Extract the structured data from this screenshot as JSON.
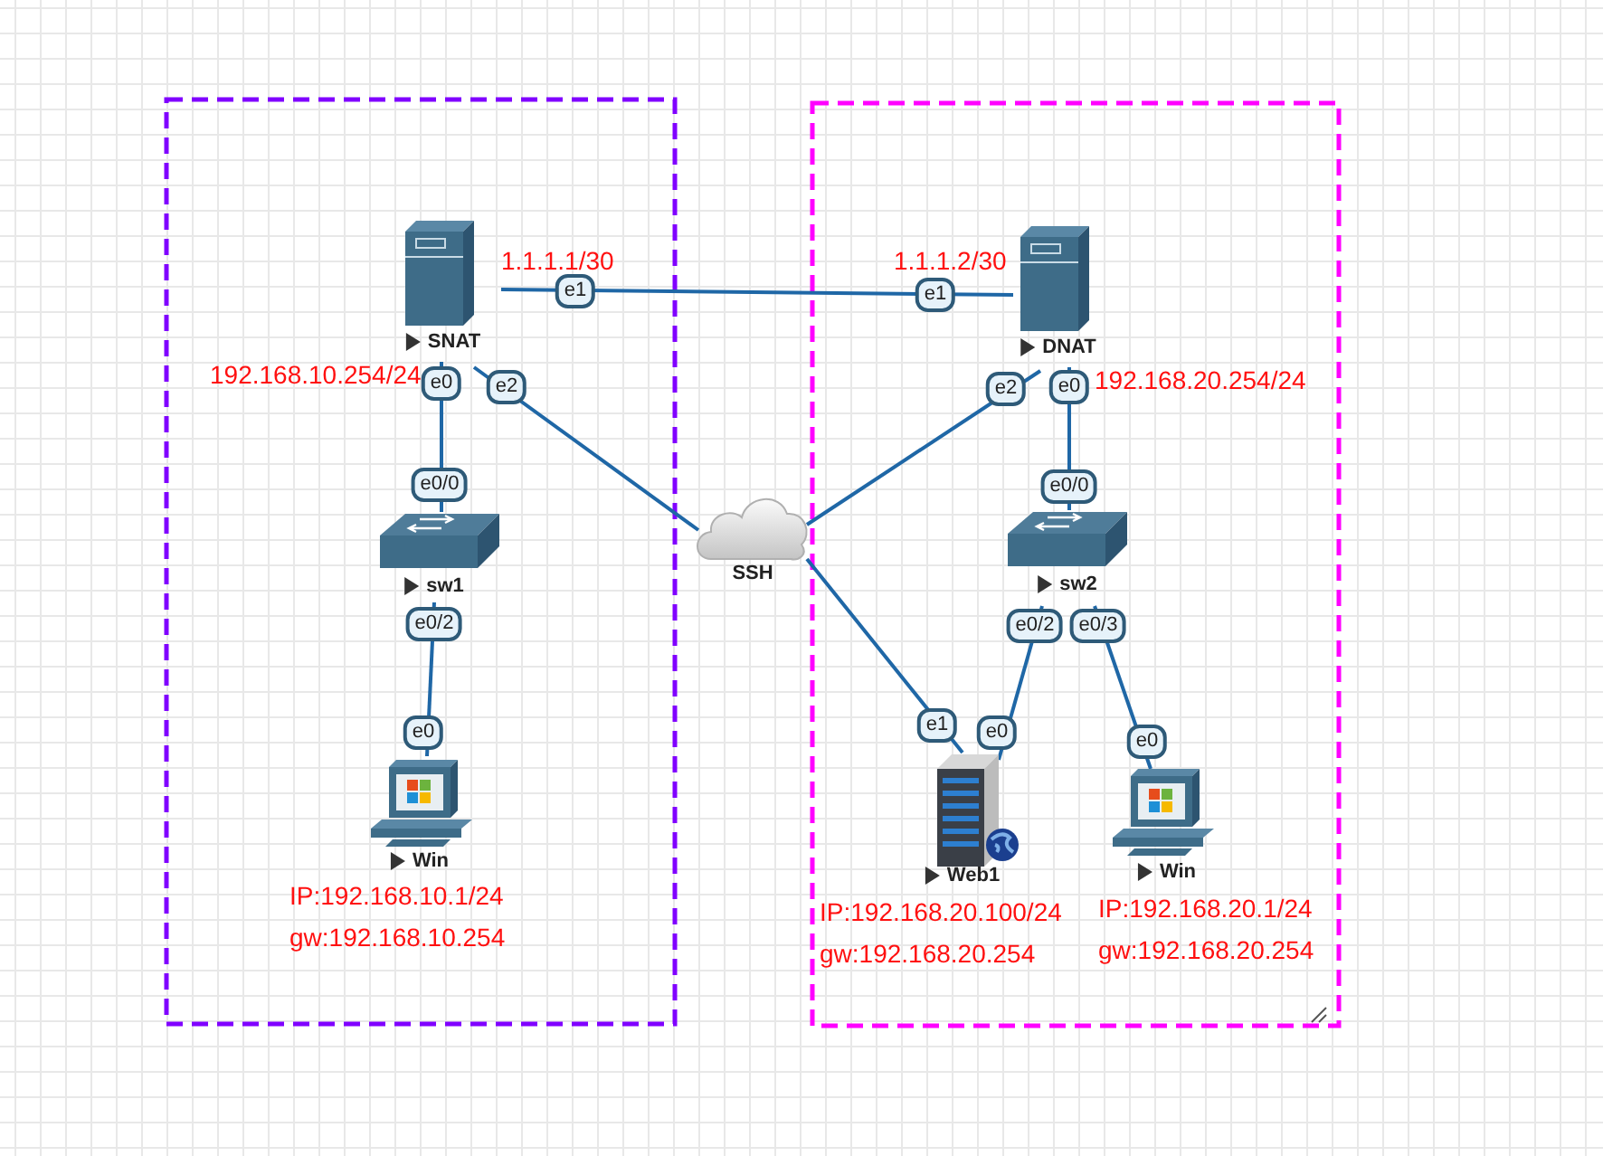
{
  "zones": [
    {
      "color": "#8000ff"
    },
    {
      "color": "#ff00ff"
    }
  ],
  "nodes": [
    {
      "kind": "firewall",
      "name": "SNAT"
    },
    {
      "kind": "firewall",
      "name": "DNAT"
    },
    {
      "kind": "switch",
      "name": "sw1"
    },
    {
      "kind": "switch",
      "name": "sw2"
    },
    {
      "kind": "cloud",
      "name": "SSH"
    },
    {
      "kind": "pc",
      "name": "Win"
    },
    {
      "kind": "server",
      "name": "Web1"
    },
    {
      "kind": "pc",
      "name": "Win"
    }
  ],
  "links": [
    {
      "ports": [
        "e1",
        "e1"
      ]
    },
    {
      "ports": [
        "e0",
        "e0/0"
      ]
    },
    {
      "ports": [
        "e2"
      ]
    },
    {
      "ports": [
        "e2"
      ]
    },
    {
      "ports": [
        "e0",
        "e0/0"
      ]
    },
    {
      "ports": [
        "e0/2",
        "e0"
      ]
    },
    {
      "ports": [
        "e1"
      ]
    },
    {
      "ports": [
        "e0/2",
        "e0"
      ]
    },
    {
      "ports": [
        "e0/3",
        "e0"
      ]
    }
  ],
  "addresses": [
    "1.1.1.1/30",
    "1.1.1.2/30",
    "192.168.10.254/24",
    "192.168.20.254/24",
    "IP:192.168.10.1/24",
    "gw:192.168.10.254",
    "IP:192.168.20.100/24",
    "gw:192.168.20.254",
    "IP:192.168.20.1/24",
    "gw:192.168.20.254"
  ]
}
